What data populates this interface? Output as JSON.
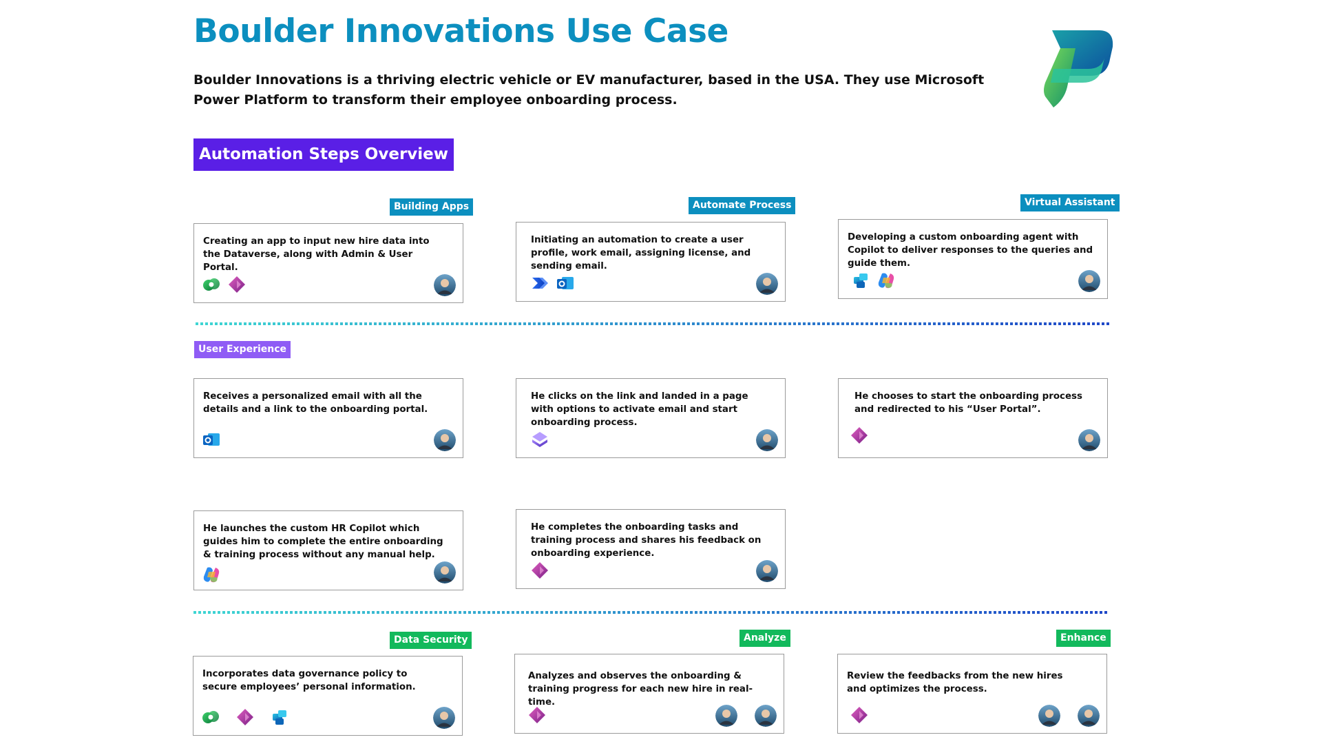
{
  "page": {
    "title": "Boulder Innovations Use Case",
    "intro": "Boulder Innovations is a thriving electric vehicle or EV manufacturer, based in the USA. They use Microsoft Power Platform to transform their employee onboarding process.",
    "logo_icon": "power-platform-logo-icon"
  },
  "overview": {
    "label": "Automation Steps Overview"
  },
  "sections": {
    "building": {
      "tag": "Building Apps",
      "text": "Creating an app to input new hire data into the Dataverse, along with Admin & User Portal.",
      "icons": [
        "dataverse-icon",
        "power-apps-icon"
      ]
    },
    "automate": {
      "tag": "Automate Process",
      "text": "Initiating an automation to create a user profile, work email, assigning license, and sending email.",
      "icons": [
        "power-automate-icon",
        "outlook-icon"
      ]
    },
    "assistant": {
      "tag": "Virtual Assistant",
      "text": "Developing a custom onboarding agent with Copilot to deliver responses to the  queries and guide them.",
      "icons": [
        "copilot-studio-icon",
        "copilot-icon"
      ]
    },
    "ux": {
      "tag": "User Experience",
      "cards": [
        {
          "text": "Receives a personalized email with all the details and a link to the onboarding portal.",
          "icon": "outlook-icon"
        },
        {
          "text": "He clicks on the link and landed in a page with options to activate email and start onboarding process.",
          "icon": "power-pages-icon"
        },
        {
          "text": "He chooses to start the onboarding process and redirected to his “User Portal”.",
          "icon": "power-apps-icon"
        },
        {
          "text": "He launches the custom HR Copilot which guides him to complete the entire onboarding & training process without any manual help.",
          "icon": "copilot-icon"
        },
        {
          "text": "He completes the onboarding tasks and training process and shares his feedback on onboarding experience.",
          "icon": "power-apps-icon"
        }
      ]
    },
    "security": {
      "tag": "Data Security",
      "text": "Incorporates data governance policy to secure employees’ personal information.",
      "icons": [
        "dataverse-icon",
        "power-apps-icon",
        "copilot-studio-icon"
      ]
    },
    "analyze": {
      "tag": "Analyze",
      "text": "Analyzes and observes the onboarding & training progress for each new hire in real-time.",
      "icons": [
        "power-apps-icon"
      ]
    },
    "enhance": {
      "tag": "Enhance",
      "text": "Review the feedbacks from the new hires and optimizes the process.",
      "icons": [
        "power-apps-icon"
      ]
    }
  },
  "colors": {
    "title": "#0c8fbf",
    "overview_bg": "#5a1fe6",
    "tag_blue": "#0c8fbf",
    "tag_purple": "#8f5cf5",
    "tag_green": "#12b95c",
    "divider_start": "#3ed6d3",
    "divider_end": "#1f48c8"
  }
}
